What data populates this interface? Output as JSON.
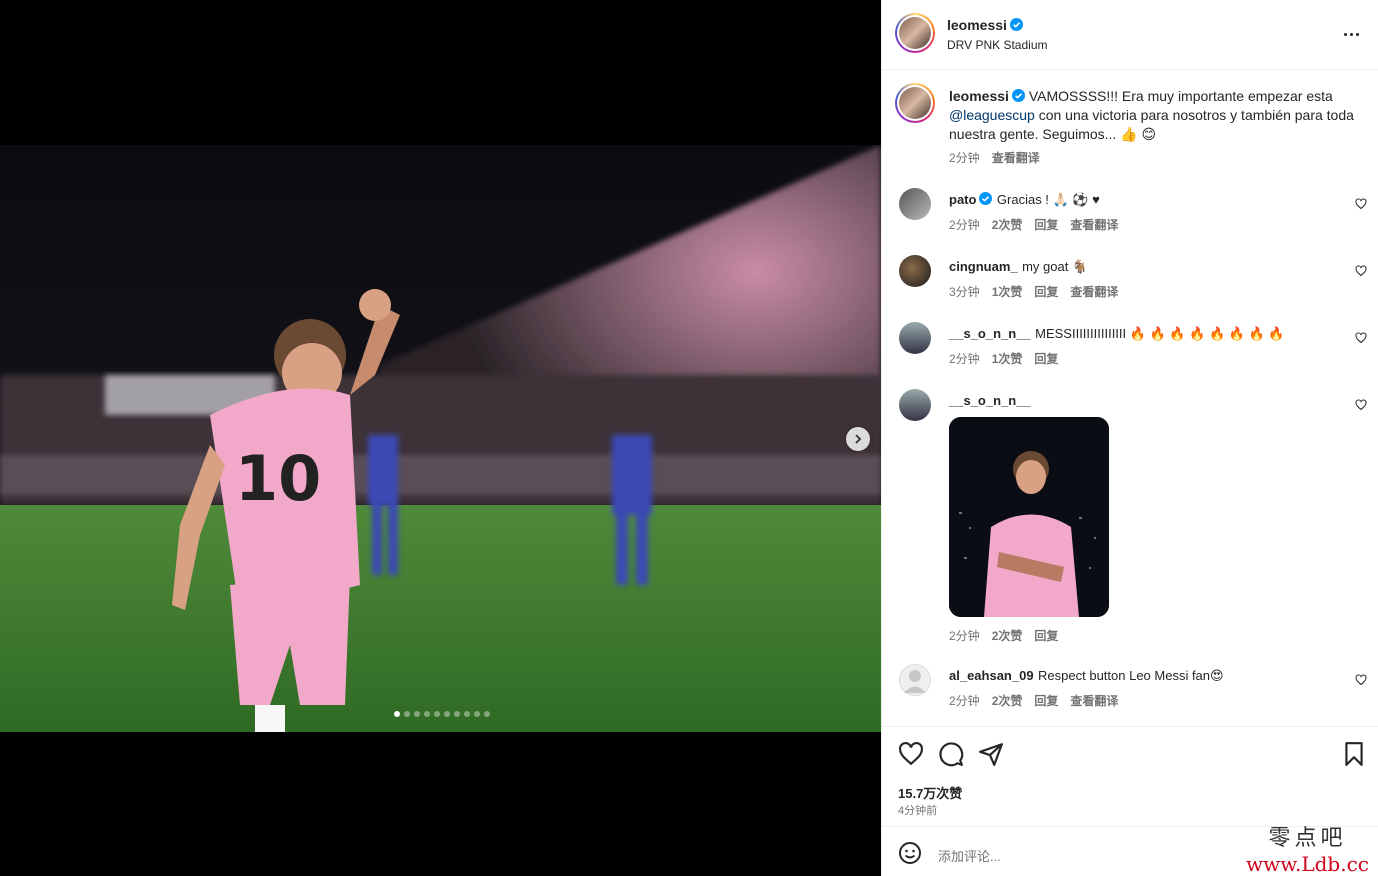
{
  "post": {
    "author": "leomessi",
    "location": "DRV PNK Stadium",
    "caption_lines": [
      "VAMOSSSS!!! Era muy importante empezar esta",
      "con una victoria para nosotros y también para toda",
      "nuestra gente. Seguimos... 👍 😊"
    ],
    "caption_mention": "@leaguescup",
    "caption_time": "2分钟",
    "see_translation": "查看翻译",
    "carousel_total": 10,
    "carousel_index": 1
  },
  "comments": [
    {
      "user": "pato",
      "verified": true,
      "text": "Gracias ! 🙏🏻 ⚽ ♥",
      "time": "2分钟",
      "likes": "2次赞",
      "reply": "回复",
      "translate": "查看翻译"
    },
    {
      "user": "cingnuam_",
      "verified": false,
      "text": "my goat 🐐",
      "time": "3分钟",
      "likes": "1次赞",
      "reply": "回复",
      "translate": "查看翻译"
    },
    {
      "user": "__s_o_n_n__",
      "verified": false,
      "text": "MESSIIIIIIIIIIIIIII 🔥 🔥 🔥 🔥 🔥 🔥 🔥 🔥",
      "time": "2分钟",
      "likes": "1次赞",
      "reply": "回复"
    },
    {
      "user": "__s_o_n_n__",
      "verified": false,
      "text": "",
      "time": "2分钟",
      "likes": "2次赞",
      "reply": "回复"
    },
    {
      "user": "al_eahsan_09",
      "verified": false,
      "text": "Respect button Leo Messi fan😍",
      "time": "2分钟",
      "likes": "2次赞",
      "reply": "回复",
      "translate": "查看翻译"
    }
  ],
  "actions": {
    "likes_count": "15.7万次赞",
    "post_time": "4分钟前",
    "add_comment_placeholder": "添加评论...",
    "icons": [
      "heart-icon",
      "comment-icon",
      "share-icon",
      "bookmark-icon"
    ]
  },
  "watermark": {
    "line1": "零点吧",
    "line2": "www.Ldb.cc"
  },
  "colors": {
    "accent": "#0095f6",
    "verified": "#0095f6",
    "text": "#262626",
    "muted": "#737373",
    "mention": "#00376b"
  }
}
